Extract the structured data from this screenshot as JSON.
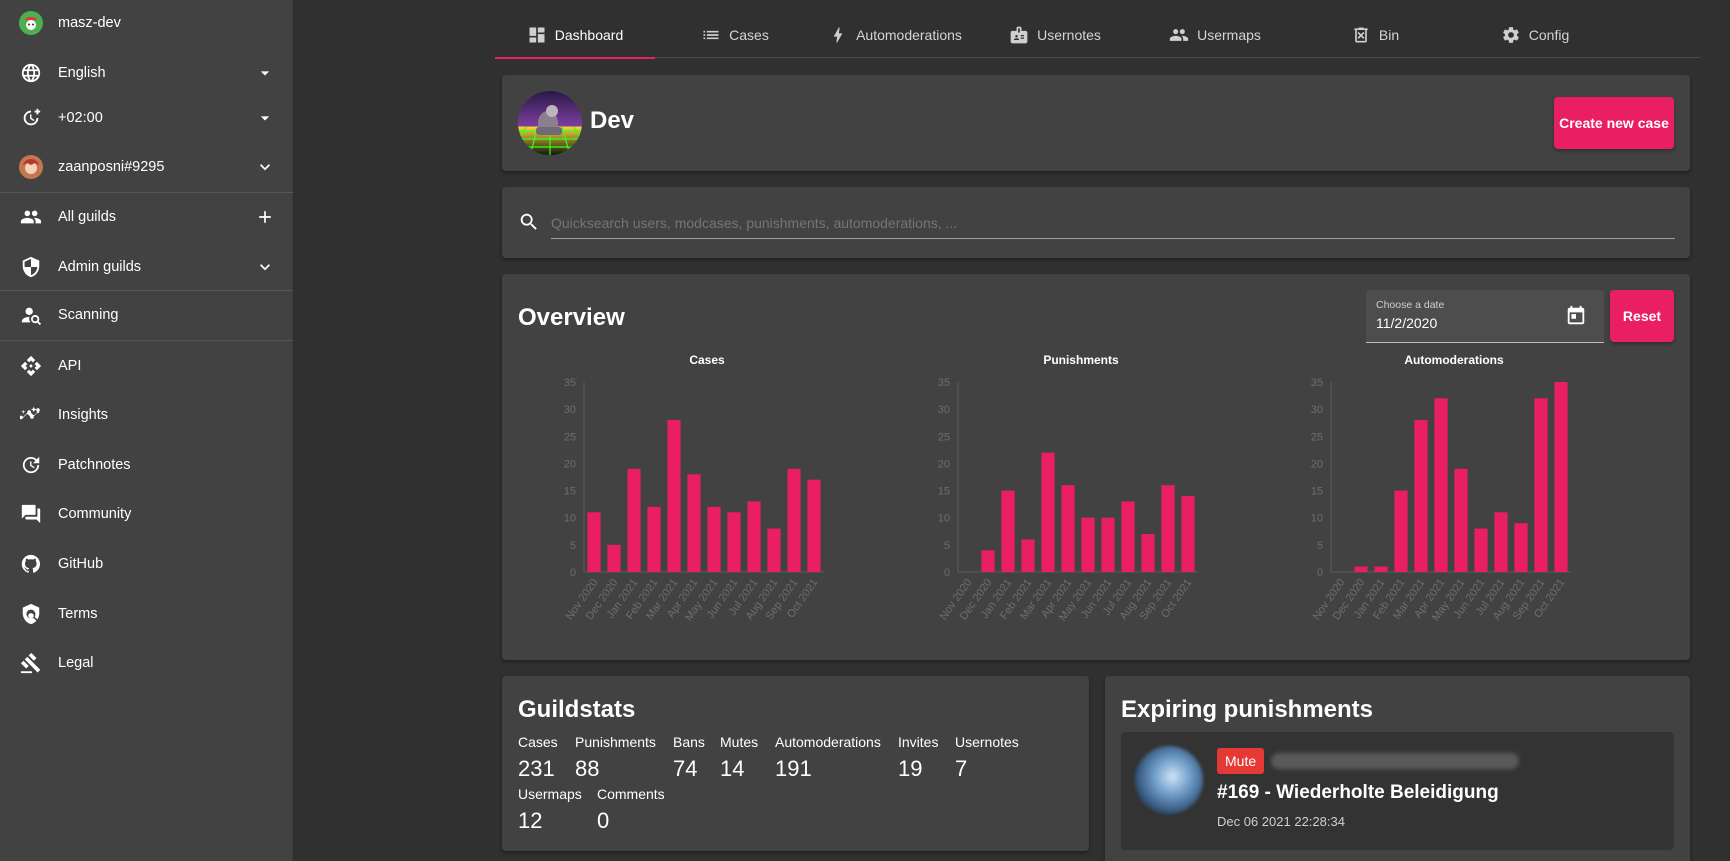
{
  "sidebar": {
    "app_name": "masz-dev",
    "language": "English",
    "timezone": "+02:00",
    "user": "zaanposni#9295",
    "all_guilds": "All guilds",
    "admin_guilds": "Admin guilds",
    "scanning": "Scanning",
    "api": "API",
    "insights": "Insights",
    "patchnotes": "Patchnotes",
    "community": "Community",
    "github": "GitHub",
    "terms": "Terms",
    "legal": "Legal"
  },
  "tabs": [
    {
      "label": "Dashboard",
      "icon": "dashboard-icon"
    },
    {
      "label": "Cases",
      "icon": "list-icon"
    },
    {
      "label": "Automoderations",
      "icon": "bolt-icon"
    },
    {
      "label": "Usernotes",
      "icon": "badge-icon"
    },
    {
      "label": "Usermaps",
      "icon": "people-icon"
    },
    {
      "label": "Bin",
      "icon": "trash-icon"
    },
    {
      "label": "Config",
      "icon": "gear-icon"
    }
  ],
  "guild": {
    "name": "Dev",
    "create_case_label": "Create new case"
  },
  "search": {
    "placeholder": "Quicksearch users, modcases, punishments, automoderations, ..."
  },
  "overview": {
    "title": "Overview",
    "date_label": "Choose a date",
    "date_value": "11/2/2020",
    "reset_label": "Reset"
  },
  "chart_data": [
    {
      "type": "bar",
      "title": "Cases",
      "categories": [
        "Nov 2020",
        "Dec 2020",
        "Jan 2021",
        "Feb 2021",
        "Mar 2021",
        "Apr 2021",
        "May 2021",
        "Jun 2021",
        "Jul 2021",
        "Aug 2021",
        "Sep 2021",
        "Oct 2021"
      ],
      "values": [
        11,
        5,
        19,
        12,
        28,
        18,
        12,
        11,
        13,
        8,
        19,
        17
      ],
      "ylim": [
        0,
        35
      ],
      "yticks": [
        0,
        5,
        10,
        15,
        20,
        25,
        30,
        35
      ],
      "color": "#e91e63"
    },
    {
      "type": "bar",
      "title": "Punishments",
      "categories": [
        "Nov 2020",
        "Dec 2020",
        "Jan 2021",
        "Feb 2021",
        "Mar 2021",
        "Apr 2021",
        "May 2021",
        "Jun 2021",
        "Jul 2021",
        "Aug 2021",
        "Sep 2021",
        "Oct 2021"
      ],
      "values": [
        0,
        4,
        15,
        6,
        22,
        16,
        10,
        10,
        13,
        7,
        16,
        14
      ],
      "ylim": [
        0,
        35
      ],
      "yticks": [
        0,
        5,
        10,
        15,
        20,
        25,
        30,
        35
      ],
      "color": "#e91e63"
    },
    {
      "type": "bar",
      "title": "Automoderations",
      "categories": [
        "Nov 2020",
        "Dec 2020",
        "Jan 2021",
        "Feb 2021",
        "Mar 2021",
        "Apr 2021",
        "May 2021",
        "Jun 2021",
        "Jul 2021",
        "Aug 2021",
        "Sep 2021",
        "Oct 2021"
      ],
      "values": [
        0,
        1,
        1,
        15,
        28,
        32,
        19,
        8,
        11,
        9,
        32,
        35
      ],
      "ylim": [
        0,
        35
      ],
      "yticks": [
        0,
        5,
        10,
        15,
        20,
        25,
        30,
        35
      ],
      "color": "#e91e63"
    }
  ],
  "guildstats": {
    "title": "Guildstats",
    "items": [
      {
        "label": "Cases",
        "value": "231"
      },
      {
        "label": "Punishments",
        "value": "88"
      },
      {
        "label": "Bans",
        "value": "74"
      },
      {
        "label": "Mutes",
        "value": "14"
      },
      {
        "label": "Automoderations",
        "value": "191"
      },
      {
        "label": "Invites",
        "value": "19"
      },
      {
        "label": "Usernotes",
        "value": "7"
      },
      {
        "label": "Usermaps",
        "value": "12"
      },
      {
        "label": "Comments",
        "value": "0"
      }
    ]
  },
  "expiring": {
    "title": "Expiring punishments",
    "items": [
      {
        "badge": "Mute",
        "title": "#169 - Wiederholte Beleidigung",
        "date": "Dec 06 2021 22:28:34"
      }
    ]
  },
  "colors": {
    "accent": "#e91e63",
    "badge": "#e53935"
  }
}
